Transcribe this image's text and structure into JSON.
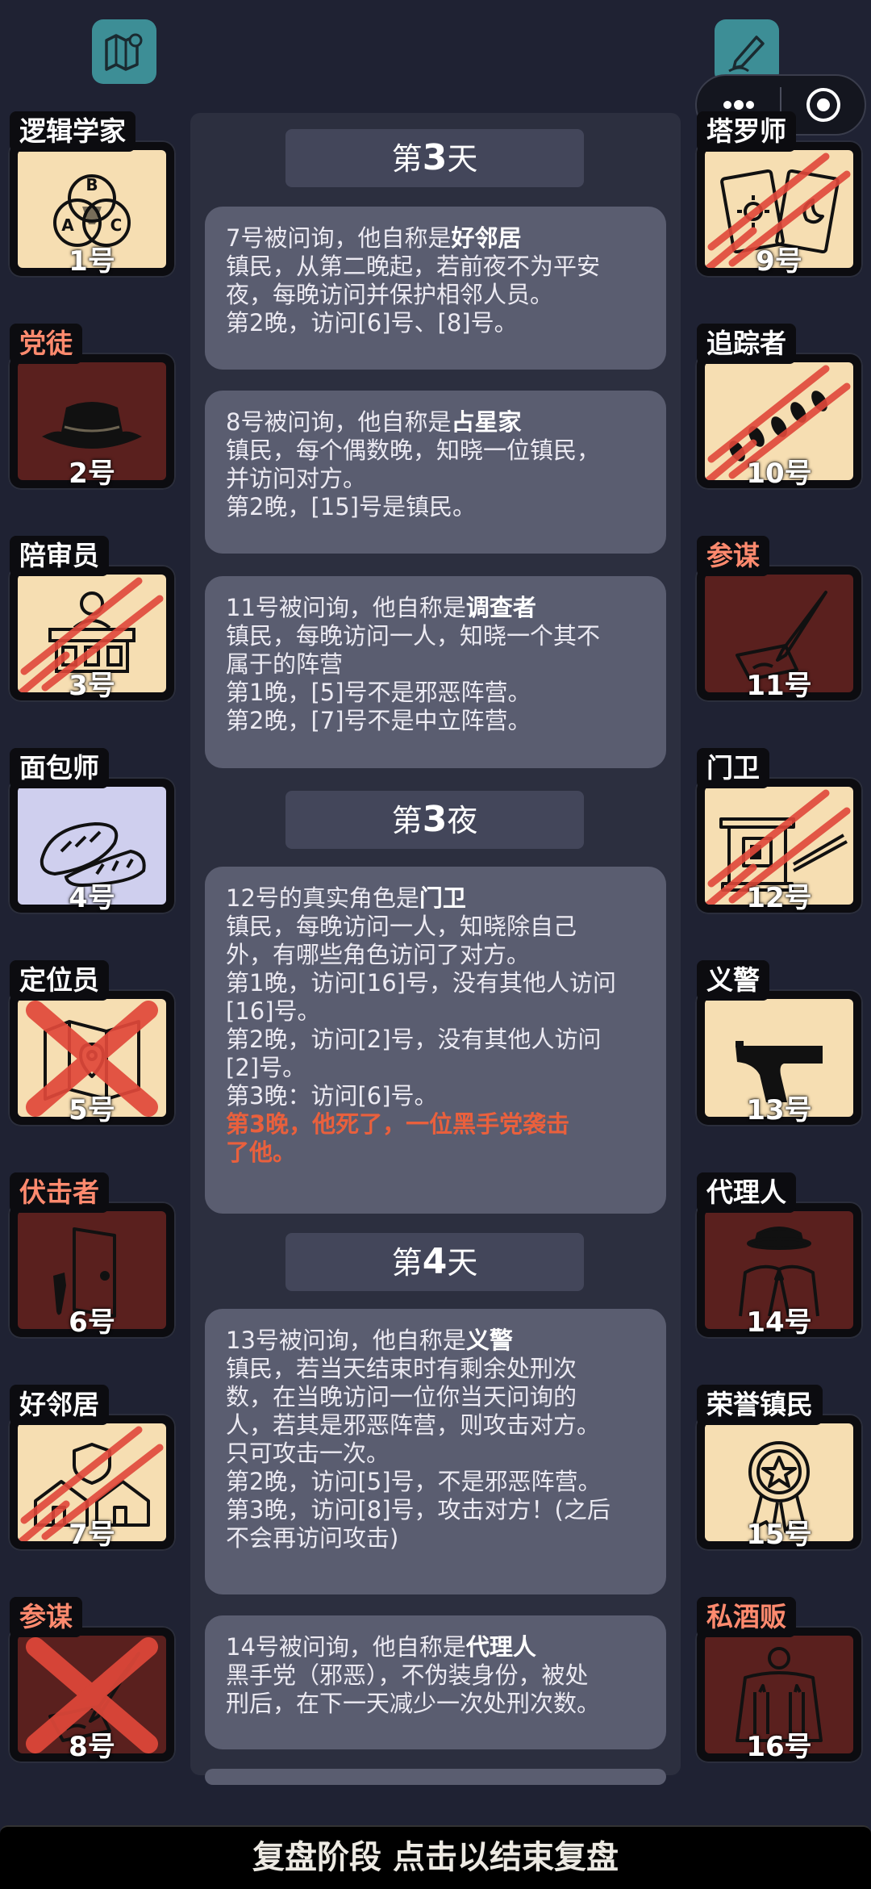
{
  "left_cards": [
    {
      "name": "逻辑学家",
      "num": "1号",
      "icon": "venn-diagram-icon",
      "bg": "cream",
      "tag": "white",
      "slashed": false,
      "crossed": false
    },
    {
      "name": "党徒",
      "num": "2号",
      "icon": "fedora-hat-icon",
      "bg": "maroon",
      "tag": "red",
      "slashed": false,
      "crossed": false
    },
    {
      "name": "陪审员",
      "num": "3号",
      "icon": "jury-box-icon",
      "bg": "cream",
      "tag": "white",
      "slashed": true,
      "crossed": false
    },
    {
      "name": "面包师",
      "num": "4号",
      "icon": "bread-icon",
      "bg": "lav",
      "tag": "white",
      "slashed": false,
      "crossed": false
    },
    {
      "name": "定位员",
      "num": "5号",
      "icon": "map-pin-icon",
      "bg": "cream",
      "tag": "white",
      "slashed": false,
      "crossed": true
    },
    {
      "name": "伏击者",
      "num": "6号",
      "icon": "door-knife-icon",
      "bg": "maroon",
      "tag": "red",
      "slashed": false,
      "crossed": false
    },
    {
      "name": "好邻居",
      "num": "7号",
      "icon": "houses-shield-icon",
      "bg": "cream",
      "tag": "white",
      "slashed": true,
      "crossed": false
    },
    {
      "name": "参谋",
      "num": "8号",
      "icon": "quill-note-icon",
      "bg": "maroon",
      "tag": "red",
      "slashed": false,
      "crossed": true
    }
  ],
  "right_cards": [
    {
      "name": "塔罗师",
      "num": "9号",
      "icon": "tarot-cards-icon",
      "bg": "cream",
      "tag": "white",
      "slashed": true,
      "crossed": false
    },
    {
      "name": "追踪者",
      "num": "10号",
      "icon": "footprints-icon",
      "bg": "cream",
      "tag": "white",
      "slashed": true,
      "crossed": false
    },
    {
      "name": "参谋",
      "num": "11号",
      "icon": "quill-note-icon",
      "bg": "maroon",
      "tag": "red",
      "slashed": false,
      "crossed": false
    },
    {
      "name": "门卫",
      "num": "12号",
      "icon": "guard-booth-icon",
      "bg": "cream",
      "tag": "white",
      "slashed": true,
      "crossed": false
    },
    {
      "name": "义警",
      "num": "13号",
      "icon": "pistol-icon",
      "bg": "cream",
      "tag": "white",
      "slashed": false,
      "crossed": false
    },
    {
      "name": "代理人",
      "num": "14号",
      "icon": "mobster-suit-icon",
      "bg": "maroon",
      "tag": "white",
      "slashed": false,
      "crossed": false
    },
    {
      "name": "荣誉镇民",
      "num": "15号",
      "icon": "medal-icon",
      "bg": "cream",
      "tag": "white",
      "slashed": false,
      "crossed": false
    },
    {
      "name": "私酒贩",
      "num": "16号",
      "icon": "bottles-coat-icon",
      "bg": "maroon",
      "tag": "red",
      "slashed": false,
      "crossed": false
    }
  ],
  "feed": {
    "day3": {
      "prefix": "第",
      "n": "3",
      "suffix": "天"
    },
    "night3": {
      "prefix": "第",
      "n": "3",
      "suffix": "夜"
    },
    "day4": {
      "prefix": "第",
      "n": "4",
      "suffix": "天"
    },
    "msgs": [
      {
        "pre": "7号被问询，他自称是",
        "role": "好邻居",
        "lines": [
          "镇民，从第二晚起，若前夜不为平安",
          "夜，每晚访问并保护相邻人员。",
          "第2晚，访问[6]号、[8]号。"
        ]
      },
      {
        "pre": "8号被问询，他自称是",
        "role": "占星家",
        "lines": [
          "镇民，每个偶数晚，知晓一位镇民，",
          "并访问对方。",
          "第2晚，[15]号是镇民。"
        ]
      },
      {
        "pre": "11号被问询，他自称是",
        "role": "调查者",
        "lines": [
          "镇民，每晚访问一人，知晓一个其不",
          "属于的阵营",
          "第1晚，[5]号不是邪恶阵营。",
          "第2晚，[7]号不是中立阵营。"
        ]
      },
      {
        "pre": "12号的真实角色是",
        "role": "门卫",
        "lines": [
          "镇民，每晚访问一人，知晓除自己",
          "外，有哪些角色访问了对方。",
          "第1晚，访问[16]号，没有其他人访问",
          "[16]号。",
          "第2晚，访问[2]号，没有其他人访问",
          "[2]号。",
          "第3晚：访问[6]号。"
        ],
        "death": [
          "第3晚，他死了，一位黑手党袭击",
          "了他。"
        ]
      },
      {
        "pre": "13号被问询，他自称是",
        "role": "义警",
        "lines": [
          "镇民，若当天结束时有剩余处刑次",
          "数，在当晚访问一位你当天问询的",
          "人，若其是邪恶阵营，则攻击对方。",
          "只可攻击一次。",
          "第2晚，访问[5]号，不是邪恶阵营。",
          "第3晚，访问[8]号，攻击对方！(之后",
          "不会再访问攻击)"
        ]
      },
      {
        "pre": "14号被问询，他自称是",
        "role": "代理人",
        "lines": [
          "黑手党（邪恶），不伪装身份，被处",
          "刑后，在下一天减少一次处刑次数。"
        ]
      }
    ]
  },
  "bottom_text": "复盘阶段 点击以结束复盘",
  "top_icons": {
    "left": "map-icon",
    "right": "edit-pen-icon"
  },
  "colors": {
    "bg": "#1f2233",
    "cream": "#f6deb2",
    "maroon": "#5a201e",
    "lavender": "#cfcfee",
    "accent": "#3d8e96",
    "death": "#e9603d",
    "slash": "#e0483a"
  }
}
